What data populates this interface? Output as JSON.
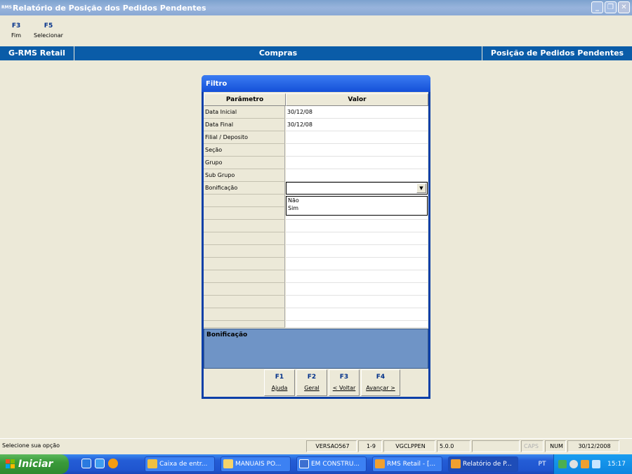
{
  "window": {
    "title": "Relatório de Posição dos Pedidos Pendentes",
    "app_icon_text": "RMS"
  },
  "toolbar": [
    {
      "key": "F3",
      "label": "Fim"
    },
    {
      "key": "F5",
      "label": "Selecionar"
    }
  ],
  "header": {
    "left": "G-RMS Retail",
    "center": "Compras",
    "right": "Posição de Pedidos Pendentes"
  },
  "filter": {
    "title": "Filtro",
    "col_param": "Parâmetro",
    "col_value": "Valor",
    "rows": [
      {
        "param": "Data Inicial",
        "value": "30/12/08"
      },
      {
        "param": "Data Final",
        "value": "30/12/08"
      },
      {
        "param": "Filial / Deposito",
        "value": ""
      },
      {
        "param": "Seção",
        "value": ""
      },
      {
        "param": "Grupo",
        "value": ""
      },
      {
        "param": "Sub Grupo",
        "value": ""
      },
      {
        "param": "Bonificação",
        "value": ""
      }
    ],
    "dropdown_options": [
      "Não",
      "Sim"
    ],
    "info_title": "Bonificação",
    "fkeys": [
      {
        "key": "F1",
        "label": "Ajuda"
      },
      {
        "key": "F2",
        "label": "Geral"
      },
      {
        "key": "F3",
        "label": "< Voltar"
      },
      {
        "key": "F4",
        "label": "Avançar >"
      }
    ]
  },
  "status": {
    "message": "Selecione sua opção",
    "version": "VERSAO567",
    "page": "1-9",
    "program": "VGCLPPEN",
    "release": "5.0.0",
    "caps": "CAPS",
    "num": "NUM",
    "date": "30/12/2008"
  },
  "taskbar": {
    "start_label": "Iniciar",
    "tasks": [
      {
        "label": "Caixa de entr...",
        "icon_color": "#f0c040"
      },
      {
        "label": "MANUAIS PO...",
        "icon_color": "#f5d36a"
      },
      {
        "label": "EM CONSTRU...",
        "icon_color": "#3d6fd0"
      },
      {
        "label": "RMS Retail - [...",
        "icon_color": "#f0a030"
      },
      {
        "label": "Relatório de P...",
        "icon_color": "#f0a030"
      }
    ],
    "language": "PT",
    "clock": "15:17"
  }
}
